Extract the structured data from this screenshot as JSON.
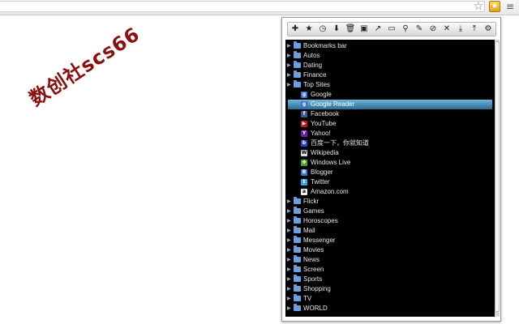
{
  "browser": {
    "star_glyph": "☆",
    "ext_glyph": "★",
    "menu_glyph": "≡"
  },
  "watermark": {
    "text": "数创社scs66"
  },
  "toolbar": {
    "icons": [
      {
        "name": "add-bookmark-icon",
        "glyph": "✚"
      },
      {
        "name": "star-icon",
        "glyph": "★"
      },
      {
        "name": "clock-icon",
        "glyph": "◷"
      },
      {
        "name": "down-arrow-icon",
        "glyph": "⬇"
      },
      {
        "name": "trash-icon",
        "glyph": "🗑"
      },
      {
        "name": "save-icon",
        "glyph": "▣"
      },
      {
        "name": "share-icon",
        "glyph": "↗"
      },
      {
        "name": "open-folder-icon",
        "glyph": "▭"
      },
      {
        "name": "search-icon",
        "glyph": "⚲"
      },
      {
        "name": "pin-icon",
        "glyph": "✎"
      },
      {
        "name": "compass-icon",
        "glyph": "⊘"
      },
      {
        "name": "close-icon",
        "glyph": "✕"
      },
      {
        "name": "download-icon",
        "glyph": "⤓"
      },
      {
        "name": "upload-icon",
        "glyph": "⤒"
      },
      {
        "name": "settings-icon",
        "glyph": "⚙"
      }
    ]
  },
  "tree": {
    "folders_top": [
      {
        "label": "Bookmarks bar"
      },
      {
        "label": "Autos"
      },
      {
        "label": "Dating"
      },
      {
        "label": "Finance"
      },
      {
        "label": "Top Sites"
      }
    ],
    "top_sites": [
      {
        "label": "Google",
        "icon": "google-icon",
        "glyph": "g",
        "color": "#3c6fd8"
      },
      {
        "label": "Google Reader",
        "icon": "google-reader-icon",
        "glyph": "g",
        "color": "#3c6fd8",
        "selected": true
      },
      {
        "label": "Facebook",
        "icon": "facebook-icon",
        "glyph": "f",
        "color": "#3b5998"
      },
      {
        "label": "YouTube",
        "icon": "youtube-icon",
        "glyph": "▶",
        "color": "#cc1111"
      },
      {
        "label": "Yahoo!",
        "icon": "yahoo-icon",
        "glyph": "Y",
        "color": "#6b1fa8"
      },
      {
        "label": "百度一下，你就知道",
        "icon": "baidu-icon",
        "glyph": "b",
        "color": "#2b45c8"
      },
      {
        "label": "Wikipedia",
        "icon": "wikipedia-icon",
        "glyph": "W",
        "color": "#dddddd"
      },
      {
        "label": "Windows Live",
        "icon": "windows-live-icon",
        "glyph": "✤",
        "color": "#4aa534"
      },
      {
        "label": "Blogger",
        "icon": "blogger-icon",
        "glyph": "B",
        "color": "#3a72d6"
      },
      {
        "label": "Twitter",
        "icon": "twitter-icon",
        "glyph": "t",
        "color": "#3aa7e0"
      },
      {
        "label": "Amazon.com",
        "icon": "amazon-icon",
        "glyph": "a",
        "color": "#eeeeee"
      }
    ],
    "folders_bottom": [
      {
        "label": "Flickr"
      },
      {
        "label": "Games"
      },
      {
        "label": "Horoscopes"
      },
      {
        "label": "Mail"
      },
      {
        "label": "Messenger"
      },
      {
        "label": "Movies"
      },
      {
        "label": "News"
      },
      {
        "label": "Screen"
      },
      {
        "label": "Sports"
      },
      {
        "label": "Shopping"
      },
      {
        "label": "TV"
      },
      {
        "label": "WORLD"
      }
    ]
  }
}
